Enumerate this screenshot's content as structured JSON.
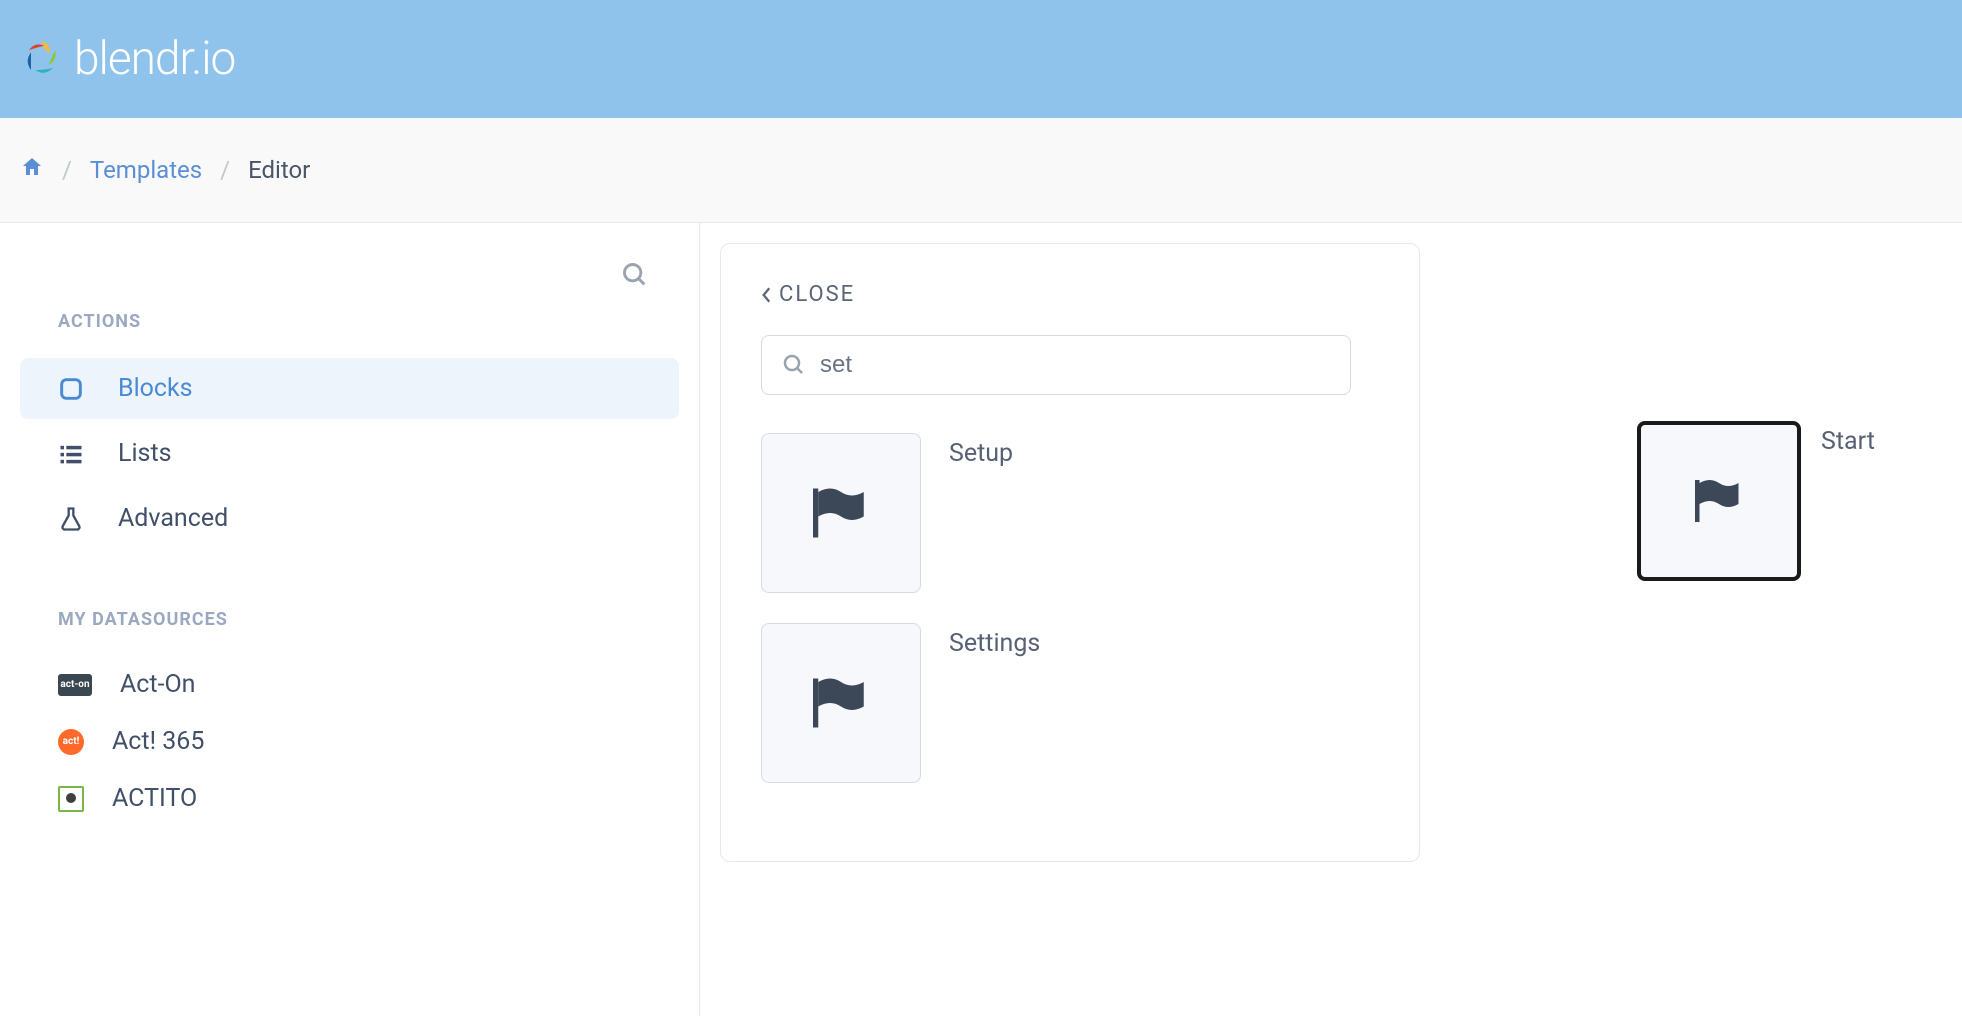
{
  "brand": "blendr.io",
  "breadcrumb": {
    "templates": "Templates",
    "editor": "Editor"
  },
  "sidebar": {
    "actions_heading": "ACTIONS",
    "datasources_heading": "MY DATASOURCES",
    "items": [
      {
        "label": "Blocks"
      },
      {
        "label": "Lists"
      },
      {
        "label": "Advanced"
      }
    ],
    "datasources": [
      {
        "label": "Act-On"
      },
      {
        "label": "Act! 365"
      },
      {
        "label": "ACTITO"
      }
    ]
  },
  "panel": {
    "close": "CLOSE",
    "search_value": "set",
    "results": [
      {
        "label": "Setup"
      },
      {
        "label": "Settings"
      }
    ]
  },
  "canvas": {
    "start_label": "Start"
  }
}
